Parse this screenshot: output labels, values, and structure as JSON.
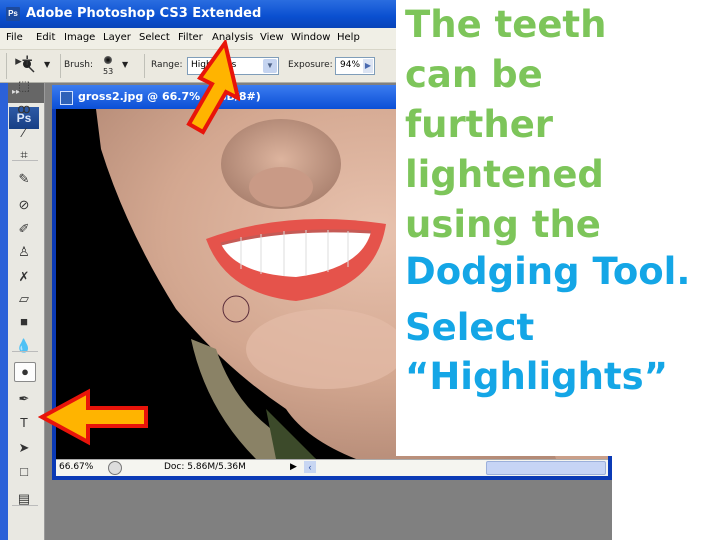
{
  "app": {
    "title": "Adobe Photoshop CS3 Extended",
    "icon_label": "Ps"
  },
  "menu": [
    "File",
    "Edit",
    "Image",
    "Layer",
    "Select",
    "Filter",
    "Analysis",
    "View",
    "Window",
    "Help"
  ],
  "options": {
    "brush_label": "Brush:",
    "brush_size": "53",
    "range_label": "Range:",
    "range_value": "Highlights",
    "exposure_label": "Exposure:",
    "exposure_value": "94%"
  },
  "toolbox": {
    "logo": "Ps",
    "collapse_glyph": "▸▸",
    "tools": [
      {
        "name": "move-tool",
        "glyph": "▸✛"
      },
      {
        "name": "marquee-tool",
        "glyph": "⬚"
      },
      {
        "name": "lasso-tool",
        "glyph": "ꝏ"
      },
      {
        "name": "magic-wand-tool",
        "glyph": "⁄"
      },
      {
        "name": "crop-tool",
        "glyph": "⌗"
      },
      {
        "name": "slice-tool",
        "glyph": "✎"
      },
      {
        "name": "healing-brush-tool",
        "glyph": "⊘"
      },
      {
        "name": "brush-tool",
        "glyph": "✐"
      },
      {
        "name": "clone-stamp-tool",
        "glyph": "♙"
      },
      {
        "name": "history-brush-tool",
        "glyph": "✗"
      },
      {
        "name": "eraser-tool",
        "glyph": "▱"
      },
      {
        "name": "gradient-tool",
        "glyph": "■"
      },
      {
        "name": "blur-tool",
        "glyph": "💧"
      },
      {
        "name": "dodge-tool",
        "glyph": "●"
      },
      {
        "name": "pen-tool",
        "glyph": "✒"
      },
      {
        "name": "type-tool",
        "glyph": "T"
      },
      {
        "name": "path-selection-tool",
        "glyph": "➤"
      },
      {
        "name": "shape-tool",
        "glyph": "□"
      },
      {
        "name": "notes-tool",
        "glyph": "▤"
      }
    ]
  },
  "document": {
    "title": "gross2.jpg @ 66.7% (RGB/8#)",
    "zoom": "66.67%",
    "doc_info": "Doc: 5.86M/5.36M"
  },
  "overlay": {
    "lines_green": [
      "The teeth",
      "can be",
      "further",
      "lightened",
      "using the"
    ],
    "lines_blue": [
      "Dodging Tool.",
      "Select",
      "“Highlights”"
    ],
    "green_color": "#7dc55a",
    "blue_color": "#14a6e6"
  },
  "annotations": {
    "arrow_color_fill": "#ffb400",
    "arrow_color_stroke": "#e8140a"
  }
}
